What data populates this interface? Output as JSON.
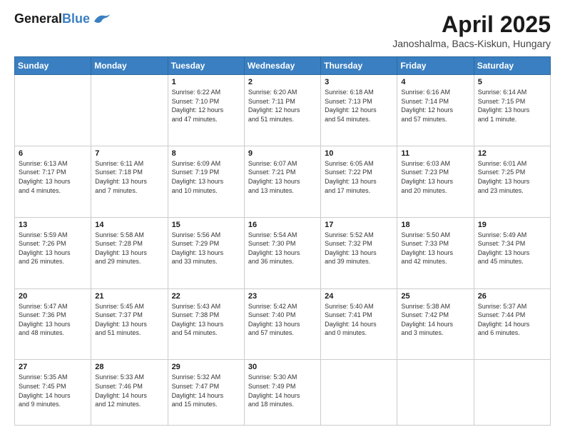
{
  "header": {
    "logo_general": "General",
    "logo_blue": "Blue",
    "title": "April 2025",
    "subtitle": "Janoshalma, Bacs-Kiskun, Hungary"
  },
  "days_of_week": [
    "Sunday",
    "Monday",
    "Tuesday",
    "Wednesday",
    "Thursday",
    "Friday",
    "Saturday"
  ],
  "weeks": [
    [
      {
        "day": "",
        "info": ""
      },
      {
        "day": "",
        "info": ""
      },
      {
        "day": "1",
        "info": "Sunrise: 6:22 AM\nSunset: 7:10 PM\nDaylight: 12 hours\nand 47 minutes."
      },
      {
        "day": "2",
        "info": "Sunrise: 6:20 AM\nSunset: 7:11 PM\nDaylight: 12 hours\nand 51 minutes."
      },
      {
        "day": "3",
        "info": "Sunrise: 6:18 AM\nSunset: 7:13 PM\nDaylight: 12 hours\nand 54 minutes."
      },
      {
        "day": "4",
        "info": "Sunrise: 6:16 AM\nSunset: 7:14 PM\nDaylight: 12 hours\nand 57 minutes."
      },
      {
        "day": "5",
        "info": "Sunrise: 6:14 AM\nSunset: 7:15 PM\nDaylight: 13 hours\nand 1 minute."
      }
    ],
    [
      {
        "day": "6",
        "info": "Sunrise: 6:13 AM\nSunset: 7:17 PM\nDaylight: 13 hours\nand 4 minutes."
      },
      {
        "day": "7",
        "info": "Sunrise: 6:11 AM\nSunset: 7:18 PM\nDaylight: 13 hours\nand 7 minutes."
      },
      {
        "day": "8",
        "info": "Sunrise: 6:09 AM\nSunset: 7:19 PM\nDaylight: 13 hours\nand 10 minutes."
      },
      {
        "day": "9",
        "info": "Sunrise: 6:07 AM\nSunset: 7:21 PM\nDaylight: 13 hours\nand 13 minutes."
      },
      {
        "day": "10",
        "info": "Sunrise: 6:05 AM\nSunset: 7:22 PM\nDaylight: 13 hours\nand 17 minutes."
      },
      {
        "day": "11",
        "info": "Sunrise: 6:03 AM\nSunset: 7:23 PM\nDaylight: 13 hours\nand 20 minutes."
      },
      {
        "day": "12",
        "info": "Sunrise: 6:01 AM\nSunset: 7:25 PM\nDaylight: 13 hours\nand 23 minutes."
      }
    ],
    [
      {
        "day": "13",
        "info": "Sunrise: 5:59 AM\nSunset: 7:26 PM\nDaylight: 13 hours\nand 26 minutes."
      },
      {
        "day": "14",
        "info": "Sunrise: 5:58 AM\nSunset: 7:28 PM\nDaylight: 13 hours\nand 29 minutes."
      },
      {
        "day": "15",
        "info": "Sunrise: 5:56 AM\nSunset: 7:29 PM\nDaylight: 13 hours\nand 33 minutes."
      },
      {
        "day": "16",
        "info": "Sunrise: 5:54 AM\nSunset: 7:30 PM\nDaylight: 13 hours\nand 36 minutes."
      },
      {
        "day": "17",
        "info": "Sunrise: 5:52 AM\nSunset: 7:32 PM\nDaylight: 13 hours\nand 39 minutes."
      },
      {
        "day": "18",
        "info": "Sunrise: 5:50 AM\nSunset: 7:33 PM\nDaylight: 13 hours\nand 42 minutes."
      },
      {
        "day": "19",
        "info": "Sunrise: 5:49 AM\nSunset: 7:34 PM\nDaylight: 13 hours\nand 45 minutes."
      }
    ],
    [
      {
        "day": "20",
        "info": "Sunrise: 5:47 AM\nSunset: 7:36 PM\nDaylight: 13 hours\nand 48 minutes."
      },
      {
        "day": "21",
        "info": "Sunrise: 5:45 AM\nSunset: 7:37 PM\nDaylight: 13 hours\nand 51 minutes."
      },
      {
        "day": "22",
        "info": "Sunrise: 5:43 AM\nSunset: 7:38 PM\nDaylight: 13 hours\nand 54 minutes."
      },
      {
        "day": "23",
        "info": "Sunrise: 5:42 AM\nSunset: 7:40 PM\nDaylight: 13 hours\nand 57 minutes."
      },
      {
        "day": "24",
        "info": "Sunrise: 5:40 AM\nSunset: 7:41 PM\nDaylight: 14 hours\nand 0 minutes."
      },
      {
        "day": "25",
        "info": "Sunrise: 5:38 AM\nSunset: 7:42 PM\nDaylight: 14 hours\nand 3 minutes."
      },
      {
        "day": "26",
        "info": "Sunrise: 5:37 AM\nSunset: 7:44 PM\nDaylight: 14 hours\nand 6 minutes."
      }
    ],
    [
      {
        "day": "27",
        "info": "Sunrise: 5:35 AM\nSunset: 7:45 PM\nDaylight: 14 hours\nand 9 minutes."
      },
      {
        "day": "28",
        "info": "Sunrise: 5:33 AM\nSunset: 7:46 PM\nDaylight: 14 hours\nand 12 minutes."
      },
      {
        "day": "29",
        "info": "Sunrise: 5:32 AM\nSunset: 7:47 PM\nDaylight: 14 hours\nand 15 minutes."
      },
      {
        "day": "30",
        "info": "Sunrise: 5:30 AM\nSunset: 7:49 PM\nDaylight: 14 hours\nand 18 minutes."
      },
      {
        "day": "",
        "info": ""
      },
      {
        "day": "",
        "info": ""
      },
      {
        "day": "",
        "info": ""
      }
    ]
  ]
}
